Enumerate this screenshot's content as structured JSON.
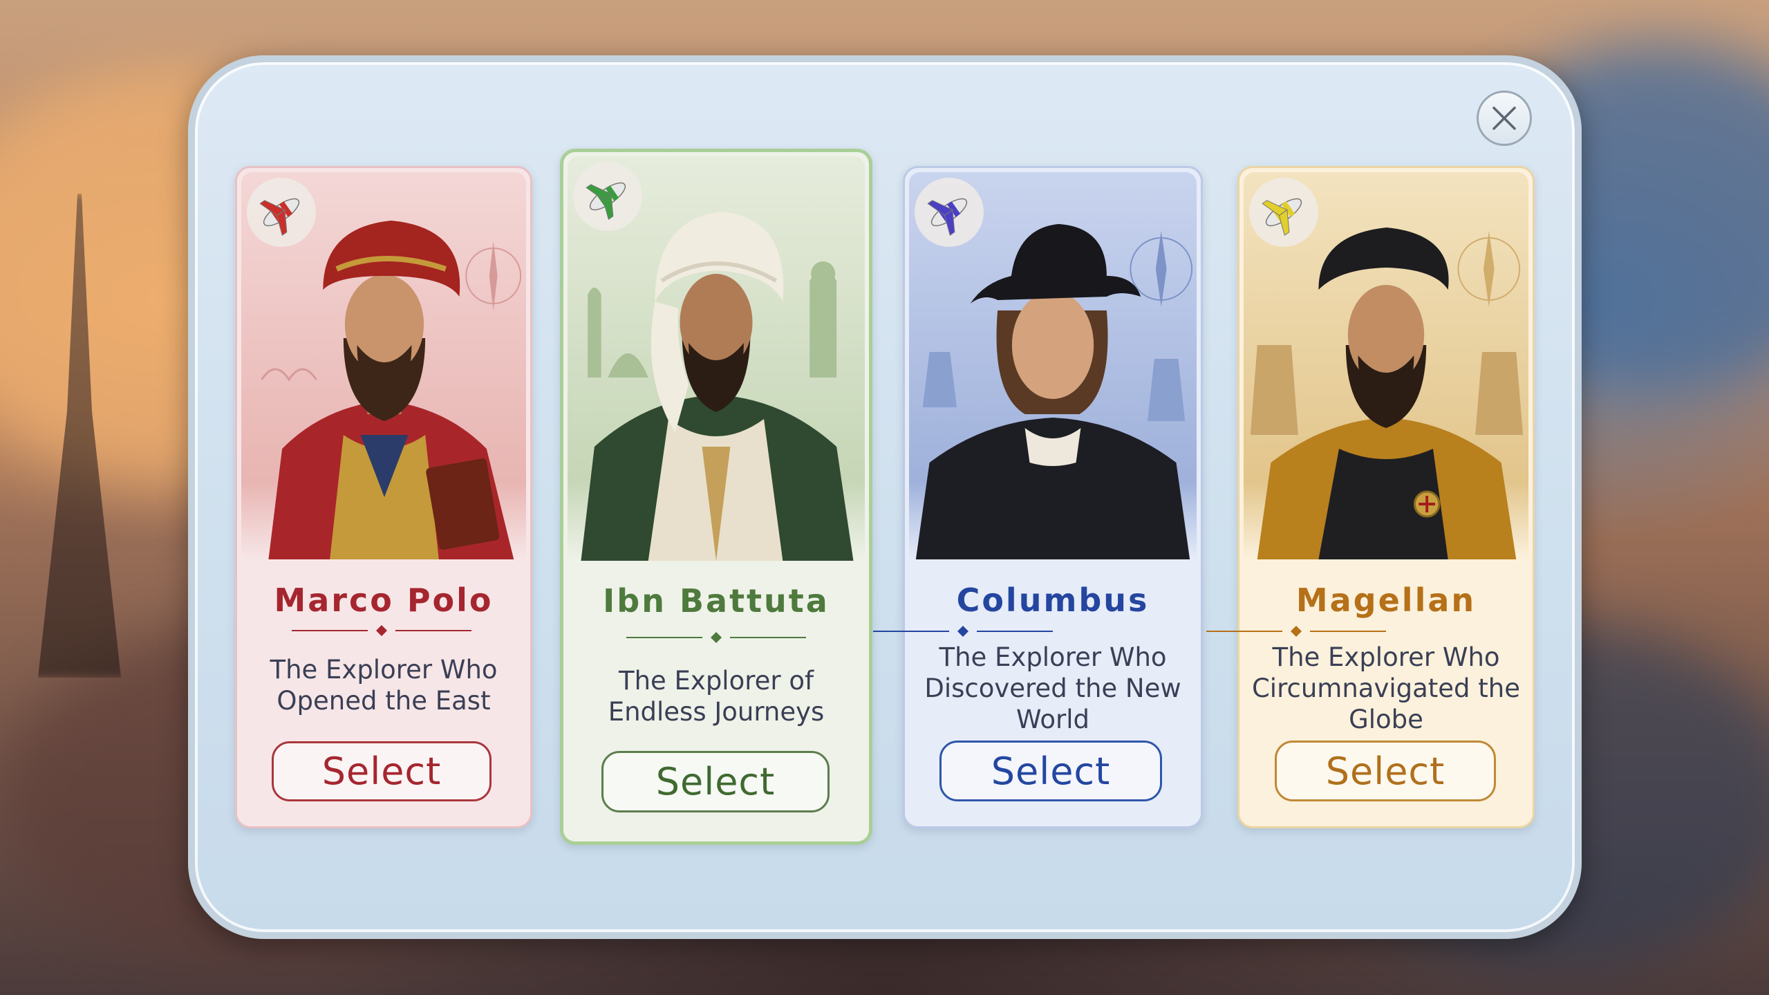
{
  "dialog": {
    "close_icon": "close-icon"
  },
  "explorers": [
    {
      "name": "Marco Polo",
      "description": "The Explorer Who Opened the East",
      "select_label": "Select",
      "accent": "#a5262f",
      "emblem_icon": "red-plane-icon",
      "selected": false
    },
    {
      "name": "Ibn Battuta",
      "description": "The Explorer of Endless Journeys",
      "select_label": "Select",
      "accent": "#4e7a3d",
      "emblem_icon": "green-plane-icon",
      "selected": true
    },
    {
      "name": "Columbus",
      "description": "The Explorer Who Discovered the New World",
      "select_label": "Select",
      "accent": "#2446a0",
      "emblem_icon": "purple-plane-icon",
      "selected": false
    },
    {
      "name": "Magellan",
      "description": "The Explorer Who Circumnavigated the Globe",
      "select_label": "Select",
      "accent": "#b57018",
      "emblem_icon": "yellow-plane-icon",
      "selected": false
    }
  ]
}
